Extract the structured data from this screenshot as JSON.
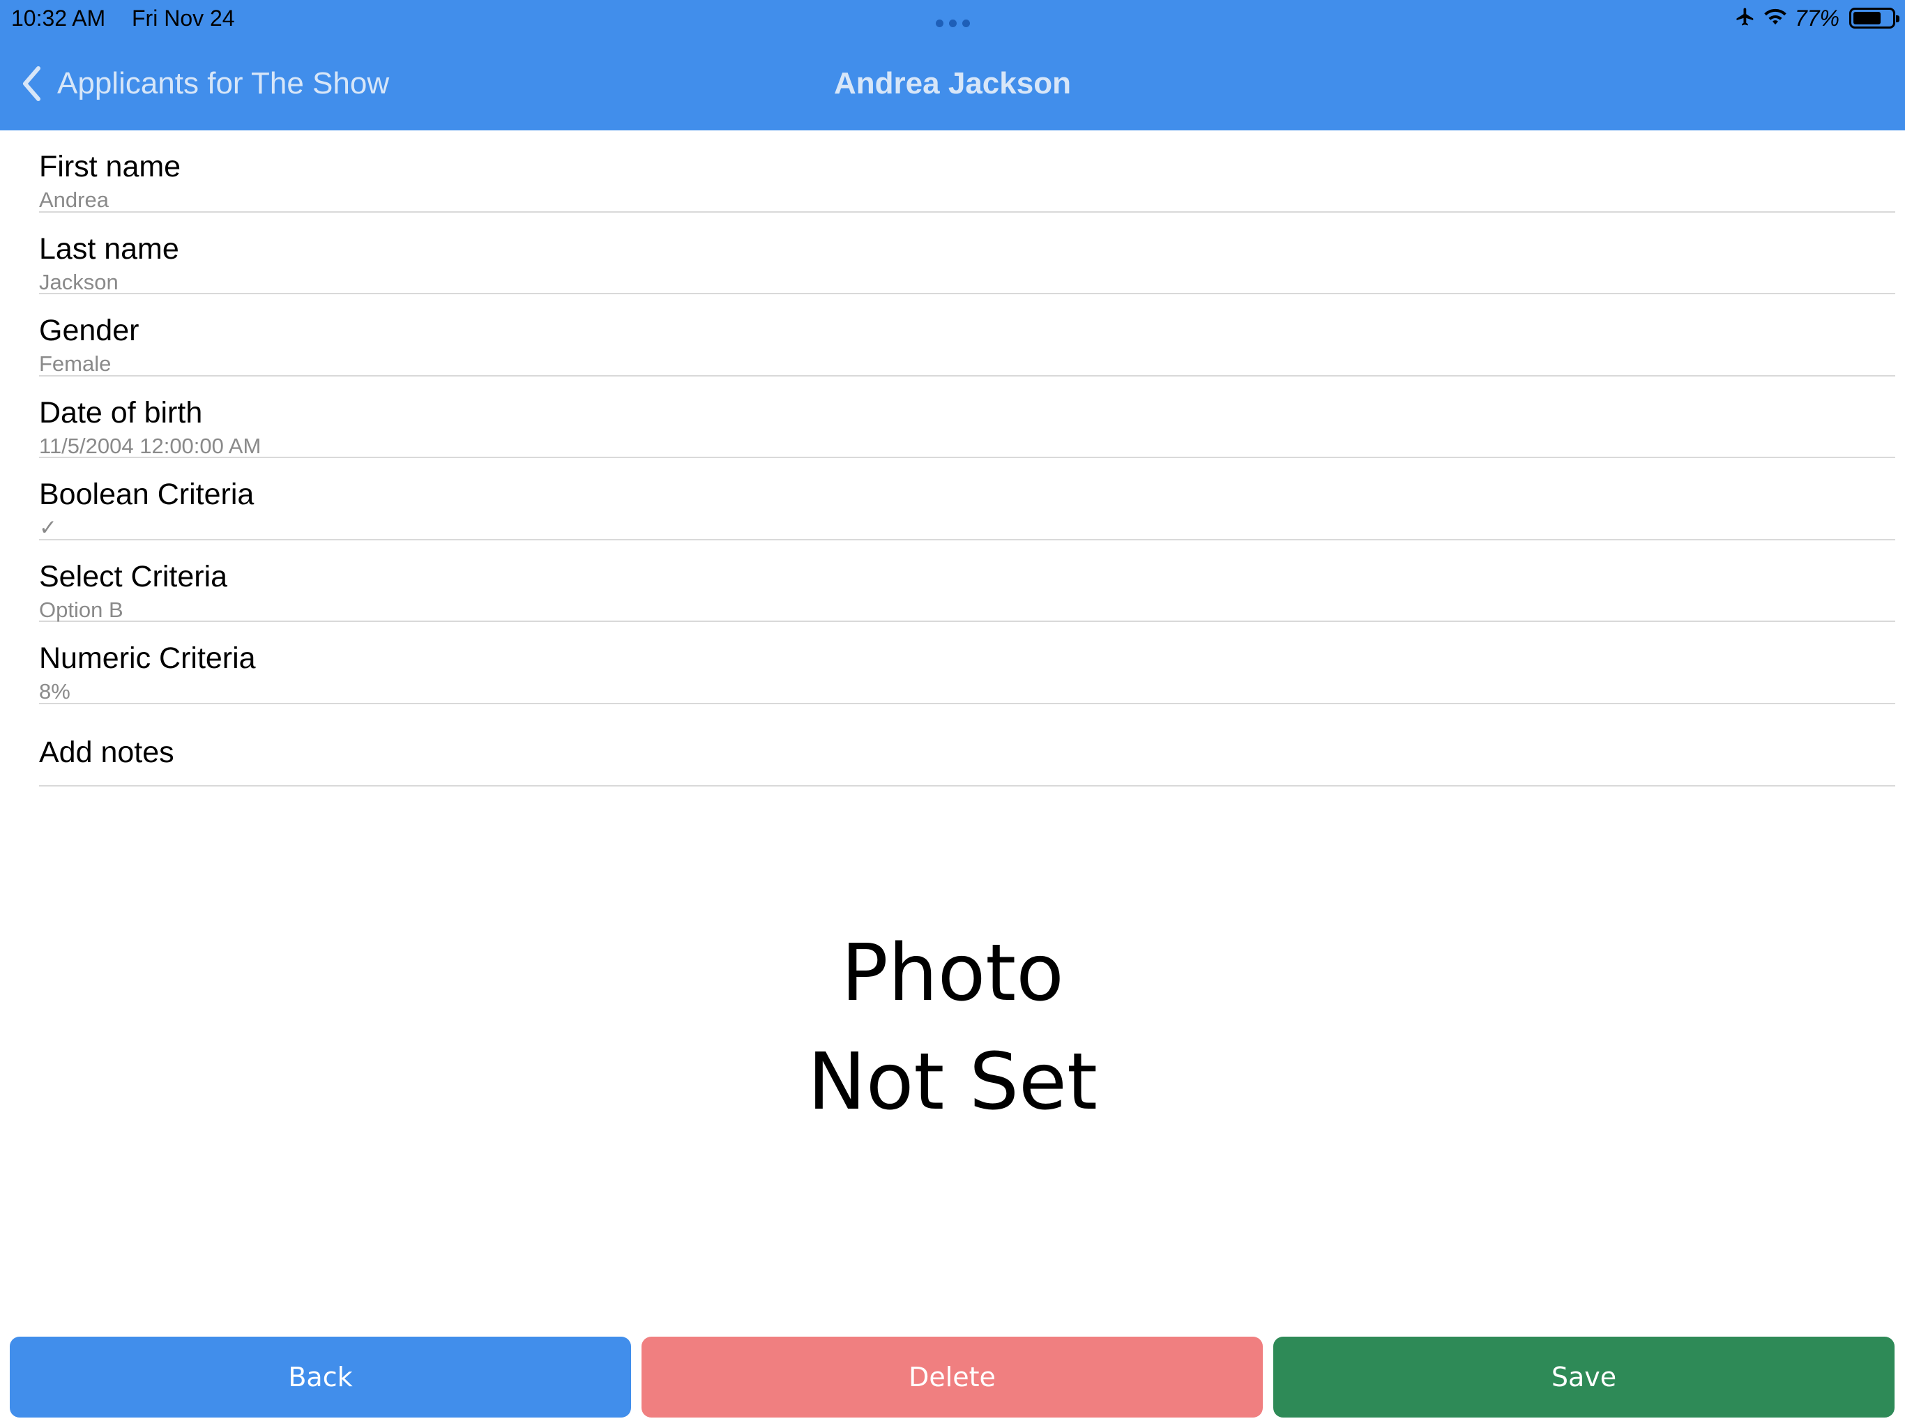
{
  "status_bar": {
    "time": "10:32 AM",
    "date": "Fri Nov 24",
    "battery_percent": "77%",
    "battery_level": 0.77,
    "icons": [
      "airplane-icon",
      "wifi-icon",
      "battery-icon"
    ]
  },
  "nav": {
    "back_label": "Applicants for The Show",
    "title": "Andrea Jackson"
  },
  "fields": [
    {
      "label": "First name",
      "value": "Andrea"
    },
    {
      "label": "Last name",
      "value": "Jackson"
    },
    {
      "label": "Gender",
      "value": "Female"
    },
    {
      "label": "Date of birth",
      "value": "11/5/2004 12:00:00 AM"
    },
    {
      "label": "Boolean Criteria",
      "value": "✓"
    },
    {
      "label": "Select Criteria",
      "value": "Option B"
    },
    {
      "label": "Numeric Criteria",
      "value": "8%"
    }
  ],
  "notes": {
    "label": "Add notes"
  },
  "photo": {
    "line1": "Photo",
    "line2": "Not Set"
  },
  "buttons": {
    "back": "Back",
    "delete": "Delete",
    "save": "Save"
  },
  "colors": {
    "header": "#418eeb",
    "back_button": "#418eeb",
    "delete_button": "#f07f80",
    "save_button": "#2e8a57"
  }
}
